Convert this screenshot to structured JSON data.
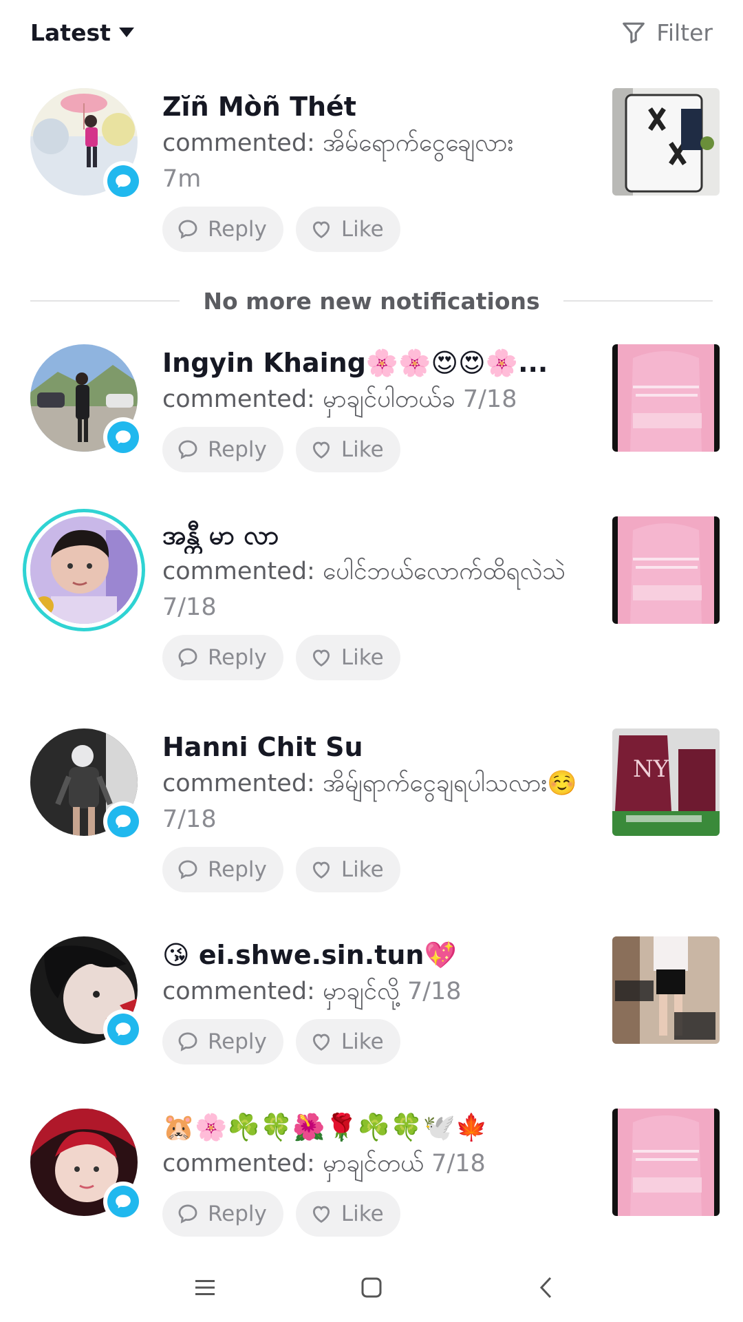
{
  "header": {
    "sort_label": "Latest",
    "filter_label": "Filter"
  },
  "divider_text": "No more new notifications",
  "actions": {
    "reply": "Reply",
    "like": "Like"
  },
  "notifications": [
    {
      "name": "Zĭñ Mòñ Thét",
      "comment": "commented: အိမ်ရောက်ငွေချေလား",
      "time": "7m"
    },
    {
      "name": "Ingyin Khaing🌸🌸😍😍🌸...",
      "comment": "commented: မှာချင်ပါတယ်ခ",
      "time": "7/18"
    },
    {
      "name": "အန္တီ မာ လာ",
      "comment": "commented: ပေါင်ဘယ်လောက်ထိရလဲသဲ",
      "time": "7/18"
    },
    {
      "name": "Hanni Chit Su",
      "comment": "commented: အိမ်ျရာက်ငွေချရပါသလား☺️",
      "time": "7/18"
    },
    {
      "name": "😘 ei.shwe.sin.tun💖",
      "comment": "commented: မှာချင်လို့",
      "time": "7/18"
    },
    {
      "name": "🐹🌸☘️🍀🌺🌹☘️🍀🕊️🍁",
      "comment": "commented: မှာချင်တယ်",
      "time": "7/18"
    }
  ]
}
